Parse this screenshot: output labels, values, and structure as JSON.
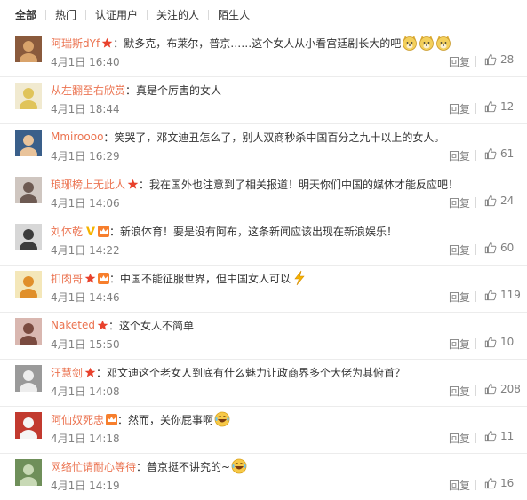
{
  "filters": [
    "全部",
    "热门",
    "认证用户",
    "关注的人",
    "陌生人"
  ],
  "comments": [
    {
      "user": "阿瑞斯dYf",
      "text": "：默多克，布莱尔，普京……这个女人从小看宫廷剧长大的吧",
      "time": "4月1日 16:40",
      "reply": "回复",
      "likes": "28",
      "badges": [
        "star"
      ],
      "emoji": [
        "doge",
        "doge",
        "doge"
      ],
      "avatar": {
        "bg": "#8a5a3c",
        "fg": "#d9a36b"
      }
    },
    {
      "user": "从左翻至右欣赏",
      "text": "：真是个厉害的女人",
      "time": "4月1日 18:44",
      "reply": "回复",
      "likes": "12",
      "badges": [],
      "emoji": [],
      "avatar": {
        "bg": "#f1ead0",
        "fg": "#e0c45a"
      }
    },
    {
      "user": "Mmiroooo",
      "text": "：笑哭了，邓文迪丑怎么了，别人双商秒杀中国百分之九十以上的女人。",
      "time": "4月1日 16:29",
      "reply": "回复",
      "likes": "61",
      "badges": [],
      "emoji": [],
      "avatar": {
        "bg": "#3a5f8a",
        "fg": "#e9c39a"
      }
    },
    {
      "user": "琅琊榜上无此人",
      "text": "：我在国外也注意到了相关报道！明天你们中国的媒体才能反应吧！",
      "time": "4月1日 14:06",
      "reply": "回复",
      "likes": "24",
      "badges": [
        "star"
      ],
      "emoji": [],
      "avatar": {
        "bg": "#cfc6c0",
        "fg": "#6d5a52"
      }
    },
    {
      "user": "刘体乾",
      "text": "：新浪体育！要是没有阿布，这条新闻应该出现在新浪娱乐！",
      "time": "4月1日 14:22",
      "reply": "回复",
      "likes": "60",
      "badges": [
        "v",
        "member"
      ],
      "emoji": [],
      "avatar": {
        "bg": "#d7d7d7",
        "fg": "#3b3b3b"
      }
    },
    {
      "user": "扣肉哥",
      "text": "：中国不能征服世界，但中国女人可以",
      "time": "4月1日 14:46",
      "reply": "回复",
      "likes": "119",
      "badges": [
        "star",
        "member"
      ],
      "emoji": [
        "lightning"
      ],
      "avatar": {
        "bg": "#f4e7b9",
        "fg": "#e08f2a"
      }
    },
    {
      "user": "Naketed",
      "text": "：这个女人不简单",
      "time": "4月1日 15:50",
      "reply": "回复",
      "likes": "10",
      "badges": [
        "star"
      ],
      "emoji": [],
      "avatar": {
        "bg": "#d9b7b0",
        "fg": "#7a4a3f"
      }
    },
    {
      "user": "汪慧剑",
      "text": "：邓文迪这个老女人到底有什么魅力让政商界多个大佬为其俯首？",
      "time": "4月1日 14:08",
      "reply": "回复",
      "likes": "208",
      "badges": [
        "star"
      ],
      "emoji": [],
      "avatar": {
        "bg": "#9a9a9a",
        "fg": "#ededed"
      }
    },
    {
      "user": "阿仙奴死忠",
      "text": "：然而，关你屁事啊",
      "time": "4月1日 14:18",
      "reply": "回复",
      "likes": "11",
      "badges": [
        "member"
      ],
      "emoji": [
        "laugh"
      ],
      "avatar": {
        "bg": "#c23a2f",
        "fg": "#f5f5f5"
      }
    },
    {
      "user": "网络忙请耐心等待",
      "text": "：普京挺不讲究的~",
      "time": "4月1日 14:19",
      "reply": "回复",
      "likes": "16",
      "badges": [],
      "emoji": [
        "laugh"
      ],
      "avatar": {
        "bg": "#6f8f5a",
        "fg": "#c8d9b5"
      }
    }
  ],
  "colors": {
    "username": "#eb7350",
    "meta": "#808080",
    "text": "#333333",
    "divider": "#ececec"
  },
  "icons": {
    "like": "thumbs-up-icon",
    "star": "star-badge-icon",
    "member": "member-badge-icon",
    "v": "verified-v-icon"
  }
}
